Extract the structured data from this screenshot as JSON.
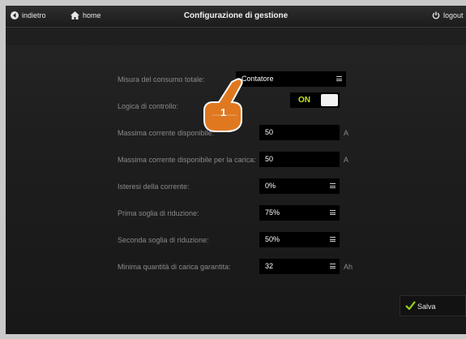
{
  "header": {
    "back_label": "indietro",
    "home_label": "home",
    "title": "Configurazione di gestione",
    "logout_label": "logout"
  },
  "rows": [
    {
      "label": "Misura del consumo totale:",
      "value": "Contatore",
      "unit": ""
    },
    {
      "label": "Logica di controllo:",
      "value": "ON",
      "unit": ""
    },
    {
      "label": "Massima corrente disponibile:",
      "value": "50",
      "unit": "A"
    },
    {
      "label": "Massima corrente disponibile per la carica:",
      "value": "50",
      "unit": "A"
    },
    {
      "label": "Isteresi della corrente:",
      "value": "0%",
      "unit": ""
    },
    {
      "label": "Prima soglia di riduzione:",
      "value": "75%",
      "unit": ""
    },
    {
      "label": "Seconda soglia di riduzione:",
      "value": "50%",
      "unit": ""
    },
    {
      "label": "Minima quantità di carica garantita:",
      "value": "32",
      "unit": "Ah"
    }
  ],
  "save_label": "Salva",
  "callout_number": "1",
  "colors": {
    "toggle_on": "#c8e020",
    "check": "#9bd21e",
    "callout": "#e07820"
  }
}
